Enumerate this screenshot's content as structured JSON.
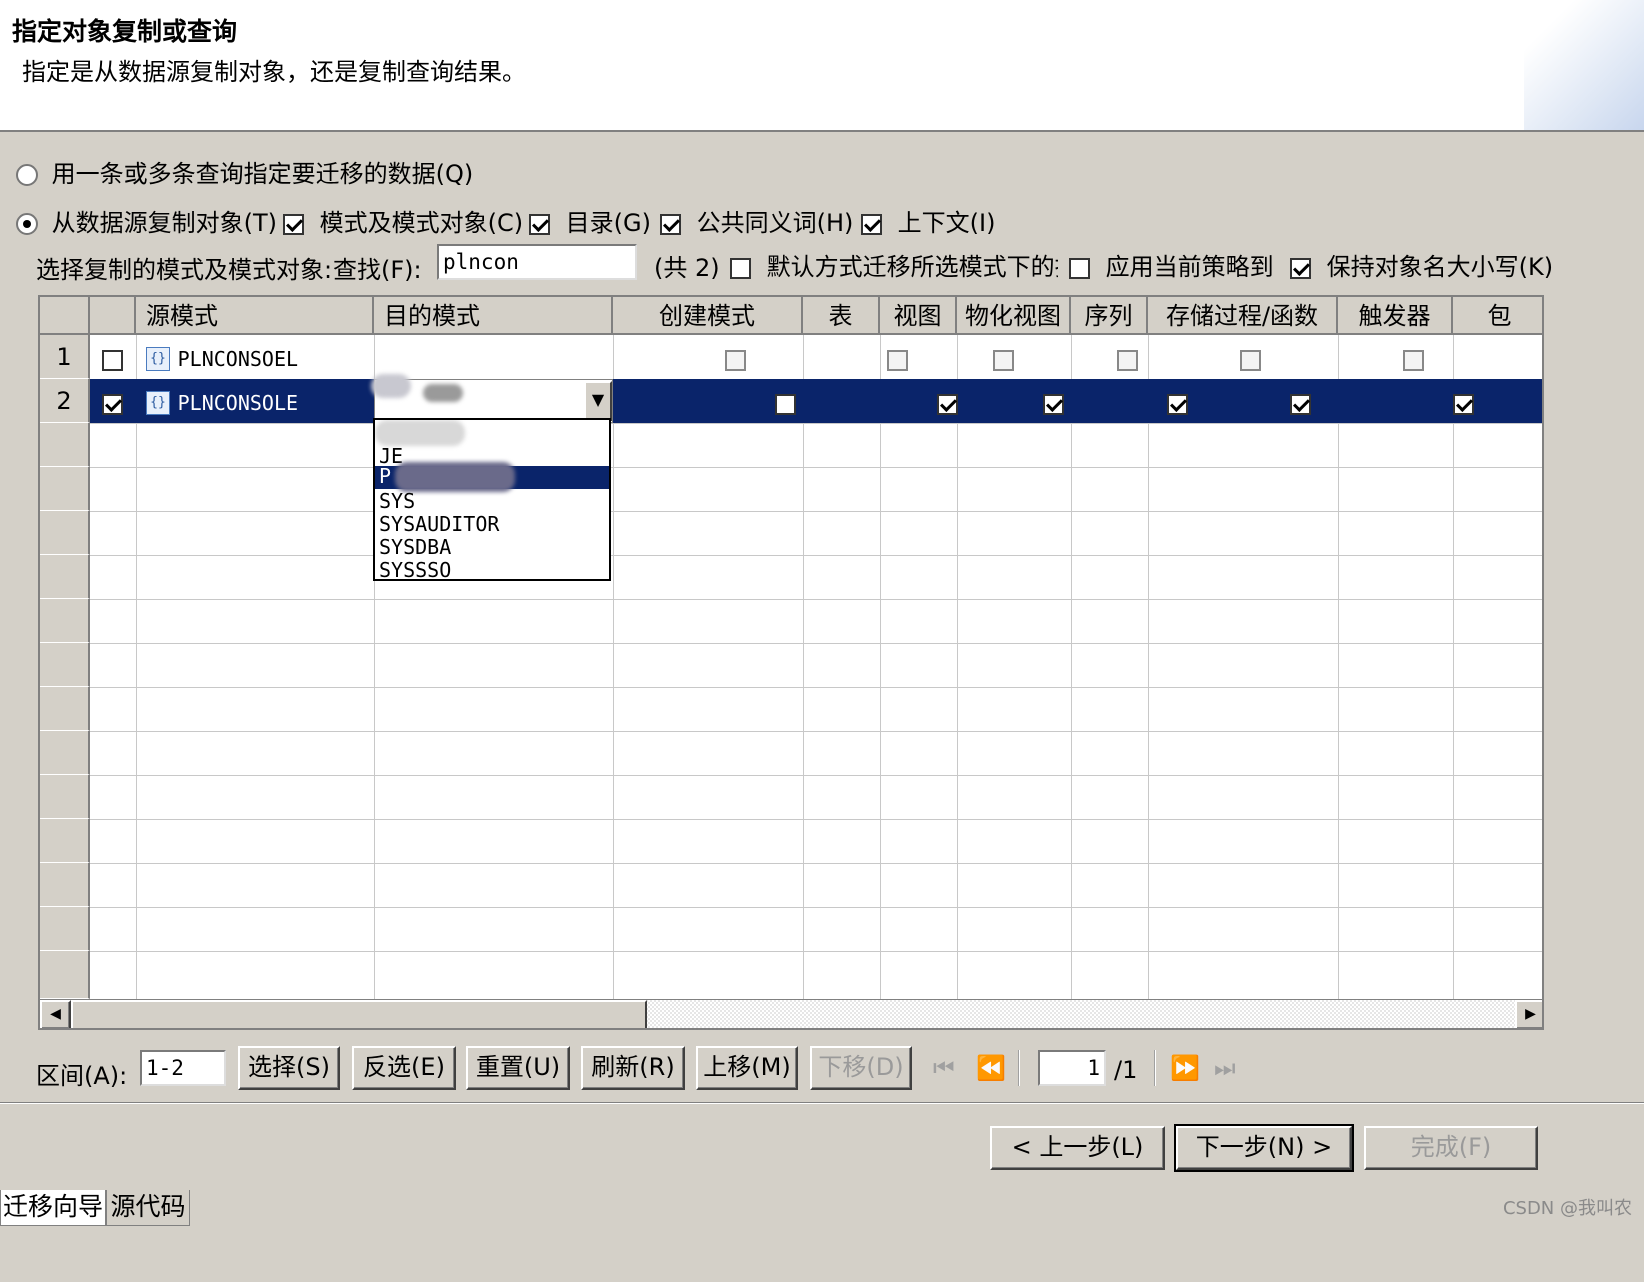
{
  "header": {
    "title": "指定对象复制或查询",
    "subtitle": "指定是从数据源复制对象，还是复制查询结果。"
  },
  "options": {
    "query_radio": "用一条或多条查询指定要迁移的数据(Q)",
    "copy_radio": "从数据源复制对象(T)",
    "schema_objects": "模式及模式对象(C)",
    "catalog": "目录(G)",
    "public_synonym": "公共同义词(H)",
    "context": "上下文(I)"
  },
  "search": {
    "label": "选择复制的模式及模式对象:",
    "find_label": "查找(F):",
    "value": "plncon",
    "count": "(共 2)",
    "default_migrate": "默认方式迁移所选模式下的指",
    "apply_policy": "应用当前策略到",
    "keep_case": "保持对象名大小写(K)"
  },
  "grid": {
    "columns": [
      "源模式",
      "目的模式",
      "创建模式",
      "表",
      "视图",
      "物化视图",
      "序列",
      "存储过程/函数",
      "触发器",
      "包"
    ],
    "rows": [
      {
        "num": "1",
        "checked": false,
        "source": "PLNCONSOEL",
        "target": "",
        "create": false,
        "table": false,
        "view": false,
        "mview": false,
        "seq": false,
        "proc": false,
        "trigger": false,
        "pkg": false
      },
      {
        "num": "2",
        "checked": true,
        "source": "PLNCONSOLE",
        "target": "",
        "create": false,
        "table": true,
        "view": true,
        "mview": true,
        "seq": true,
        "proc": true,
        "trigger": true,
        "pkg": true
      }
    ],
    "dropdown_items": [
      "JE",
      "P",
      "SYS",
      "SYSAUDITOR",
      "SYSDBA",
      "SYSSSO"
    ],
    "dropdown_selected_index": 1
  },
  "bottom": {
    "range_label": "区间(A):",
    "range_value": "1-2",
    "select_btn": "选择(S)",
    "invert_btn": "反选(E)",
    "reset_btn": "重置(U)",
    "refresh_btn": "刷新(R)",
    "up_btn": "上移(M)",
    "down_btn": "下移(D)",
    "page_value": "1",
    "page_total": "/1"
  },
  "nav": {
    "back_btn": "< 上一步(L)",
    "next_btn": "下一步(N) >",
    "finish_btn": "完成(F)"
  },
  "tabs": [
    "迁移向导",
    "源代码"
  ],
  "watermark": "CSDN @我叫农"
}
